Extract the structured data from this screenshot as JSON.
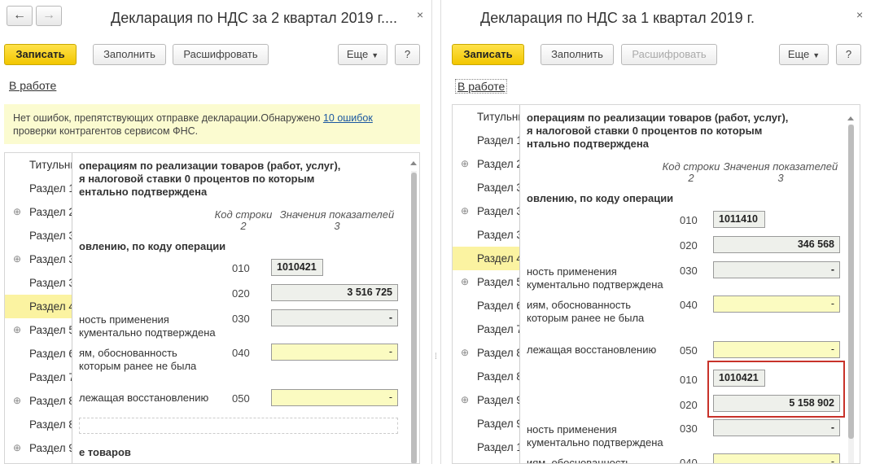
{
  "left": {
    "title": "Декларация по НДС за 2 квартал 2019 г....",
    "close": "×",
    "nav_back": "←",
    "nav_forward": "→",
    "toolbar": {
      "save": "Записать",
      "fill": "Заполнить",
      "decode": "Расшифровать",
      "more": "Еще",
      "help": "?"
    },
    "status": "В работе",
    "info": {
      "text1": "Нет ошибок, препятствующих отправке декларации.Обнаружено ",
      "link": "10 ошибок",
      "text2": "проверки контрагентов сервисом ФНС."
    },
    "tree": [
      "Титульный",
      "Раздел 1",
      "Раздел 2",
      "Раздел 3",
      "Раздел 3",
      "Раздел 3",
      "Раздел 4",
      "Раздел 5",
      "Раздел 6",
      "Раздел 7",
      "Раздел 8",
      "Раздел 9"
    ],
    "content": {
      "heading1": "операциям по реализации товаров (работ, услуг),",
      "heading2": "я налоговой ставки 0 процентов по которым",
      "heading3": "ентально подтверждена",
      "col_code": "Код строки",
      "col_code_n": "2",
      "col_values": "Значения показателей",
      "col_values_n": "3",
      "subheading": "овлению, по коду операции",
      "rows": [
        {
          "code": "010",
          "value": "1010421"
        },
        {
          "code": "020",
          "value": "3 516 725"
        },
        {
          "label1": "ность применения",
          "label2": "кументально подтверждена",
          "code": "030",
          "value": "-"
        },
        {
          "label1": "ям, обоснованность",
          "label2": "которым ранее не была",
          "code": "040",
          "value": "-"
        },
        {
          "label1": "лежащая восстановлению",
          "code": "050",
          "value": "-"
        }
      ],
      "bottom": "е товаров"
    }
  },
  "right": {
    "title": "Декларация по НДС за 1 квартал 2019 г.",
    "close": "×",
    "toolbar": {
      "save": "Записать",
      "fill": "Заполнить",
      "decode": "Расшифровать",
      "more": "Еще",
      "help": "?"
    },
    "status": "В работе",
    "tree": [
      "Титульный",
      "Раздел 1",
      "Раздел 2",
      "Раздел 3",
      "Раздел 3",
      "Раздел 3",
      "Раздел 4",
      "Раздел 5",
      "Раздел 6",
      "Раздел 7",
      "Раздел 8",
      "Раздел 8",
      "Раздел 9",
      "Раздел 9",
      "Раздел 1"
    ],
    "content": {
      "heading1": "операциям по реализации товаров (работ, услуг),",
      "heading2": "я налоговой ставки 0 процентов по которым",
      "heading3": "нтально подтверждена",
      "col_code": "Код строки",
      "col_code_n": "2",
      "col_values": "Значения показателей",
      "col_values_n": "3",
      "subheading": "овлению, по коду операции",
      "rows": [
        {
          "code": "010",
          "value": "1011410"
        },
        {
          "code": "020",
          "value": "346 568"
        },
        {
          "label1": "ность применения",
          "label2": "кументально подтверждена",
          "code": "030",
          "value": "-"
        },
        {
          "label1": "иям, обоснованность",
          "label2": "которым ранее не была",
          "code": "040",
          "value": "-"
        },
        {
          "label1": "лежащая восстановлению",
          "code": "050",
          "value": "-"
        },
        {
          "code": "010",
          "value": "1010421"
        },
        {
          "code": "020",
          "value": "5 158 902"
        },
        {
          "label1": "ность применения",
          "label2": "кументально подтверждена",
          "code": "030",
          "value": "-"
        },
        {
          "label1": "иям, обоснованность",
          "code": "040",
          "value": "-"
        }
      ]
    }
  },
  "colors": {
    "accent_yellow": "#f2c600",
    "highlight_red": "#c8322a",
    "info_bg": "#fbfbd0"
  }
}
